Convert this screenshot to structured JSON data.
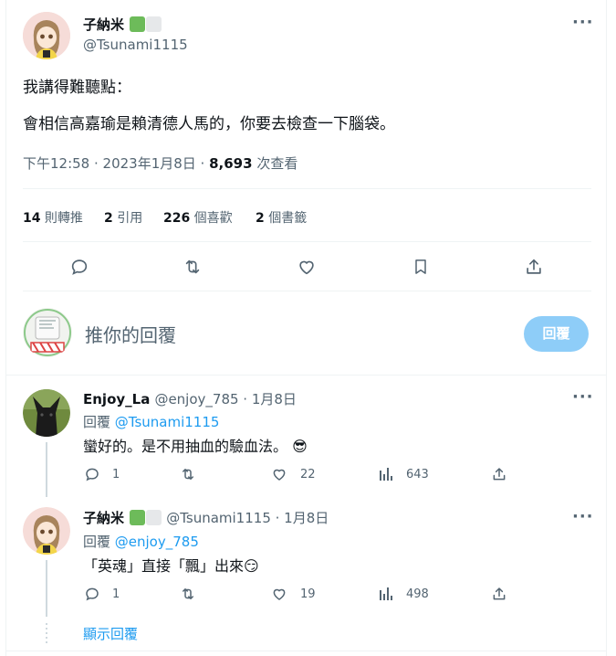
{
  "main_tweet": {
    "display_name": "子納米",
    "handle": "@Tsunami1115",
    "badge_colors": [
      "#6dbb5a",
      "#e6e8ea"
    ],
    "line1": "我講得難聽點：",
    "line2": "會相信高嘉瑜是賴清德人馬的，你要去檢查一下腦袋。",
    "timestamp": "下午12:58 · 2023年1月8日 · ",
    "views_number": "8,693",
    "views_label": " 次查看"
  },
  "stats": {
    "retweets_num": "14",
    "retweets_label": " 則轉推",
    "quotes_num": "2",
    "quotes_label": " 引用",
    "likes_num": "226",
    "likes_label": " 個喜歡",
    "bookmarks_num": "2",
    "bookmarks_label": " 個書籤"
  },
  "actions": [
    "reply-icon",
    "retweet-icon",
    "like-icon",
    "bookmark-icon",
    "share-icon"
  ],
  "reply_box": {
    "placeholder": "推你的回覆",
    "button_label": "回覆"
  },
  "replies": [
    {
      "display_name": "Enjoy_La",
      "handle": "@enjoy_785",
      "date": " · 1月8日",
      "reply_to_prefix": "回覆 ",
      "reply_to": "@Tsunami1115",
      "text": "蠻好的。是不用抽血的驗血法。",
      "emoji": "😎",
      "reply_count": "1",
      "retweet_count": "",
      "like_count": "22",
      "view_count": "643"
    },
    {
      "display_name": "子納米",
      "handle": "@Tsunami1115",
      "date": " · 1月8日",
      "reply_to_prefix": "回覆 ",
      "reply_to": "@enjoy_785",
      "text": "「英魂」直接「飄」出來",
      "emoji": "😏",
      "reply_count": "1",
      "retweet_count": "",
      "like_count": "19",
      "view_count": "498"
    }
  ],
  "show_replies": "顯示回覆",
  "colors": {
    "accent": "#1d9bf0",
    "reply_button_disabled": "#8ecdf8",
    "muted": "#536471"
  }
}
